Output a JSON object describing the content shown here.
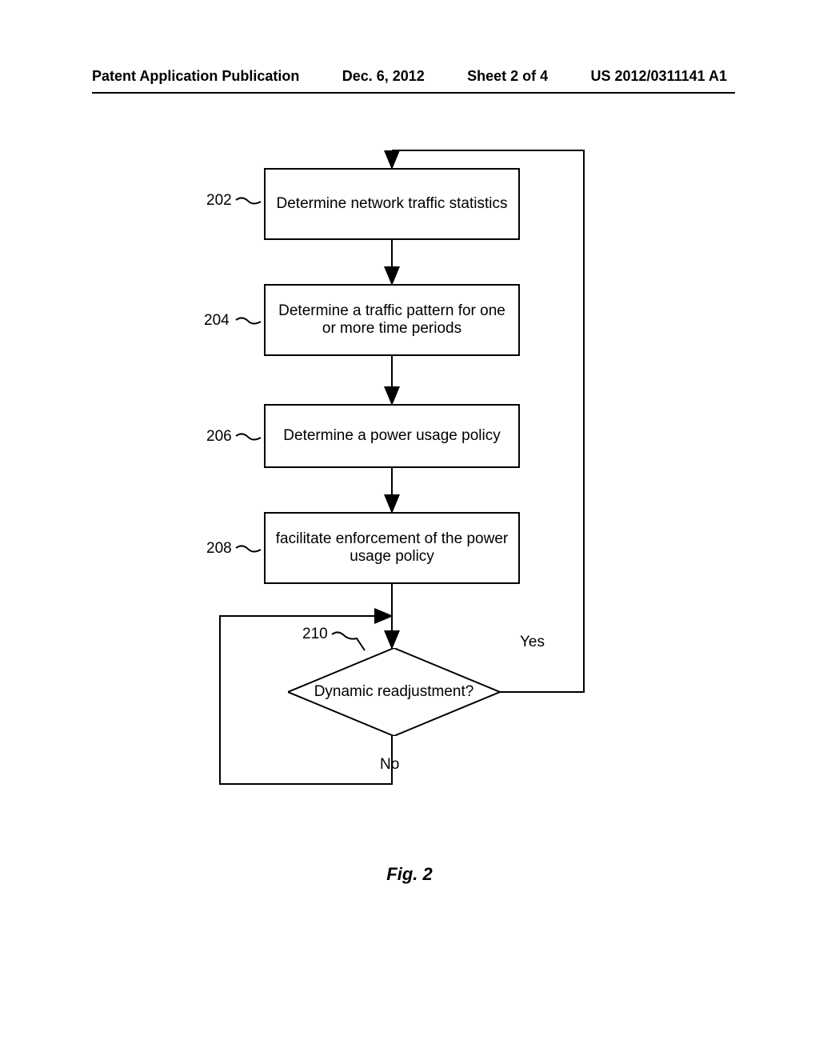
{
  "header": {
    "left": "Patent Application Publication",
    "date": "Dec. 6, 2012",
    "sheet": "Sheet 2 of 4",
    "pub_num": "US 2012/0311141 A1"
  },
  "boxes": {
    "b202": "Determine network traffic statistics",
    "b204": "Determine a traffic pattern for one or more time periods",
    "b206": "Determine a power usage policy",
    "b208": "facilitate enforcement of the power usage policy"
  },
  "decision": {
    "text": "Dynamic readjustment?",
    "yes": "Yes",
    "no": "No"
  },
  "refs": {
    "r202": "202",
    "r204": "204",
    "r206": "206",
    "r208": "208",
    "r210": "210"
  },
  "figure_label": "Fig. 2"
}
